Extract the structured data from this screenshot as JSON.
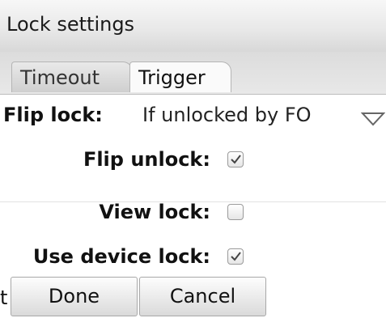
{
  "window": {
    "title": "Lock settings"
  },
  "tabs": [
    {
      "label": "Timeout",
      "selected": false
    },
    {
      "label": "Trigger",
      "selected": true
    }
  ],
  "flip_lock": {
    "label": "Flip lock:",
    "value": "If unlocked by FO",
    "icon": "dropdown-triangle-icon"
  },
  "options": [
    {
      "label": "Flip unlock:",
      "checked": true
    },
    {
      "label": "View lock:",
      "checked": false
    },
    {
      "label": "Use device lock:",
      "checked": true
    }
  ],
  "buttons": {
    "done": "Done",
    "cancel": "Cancel"
  },
  "edge_glyph": "t"
}
